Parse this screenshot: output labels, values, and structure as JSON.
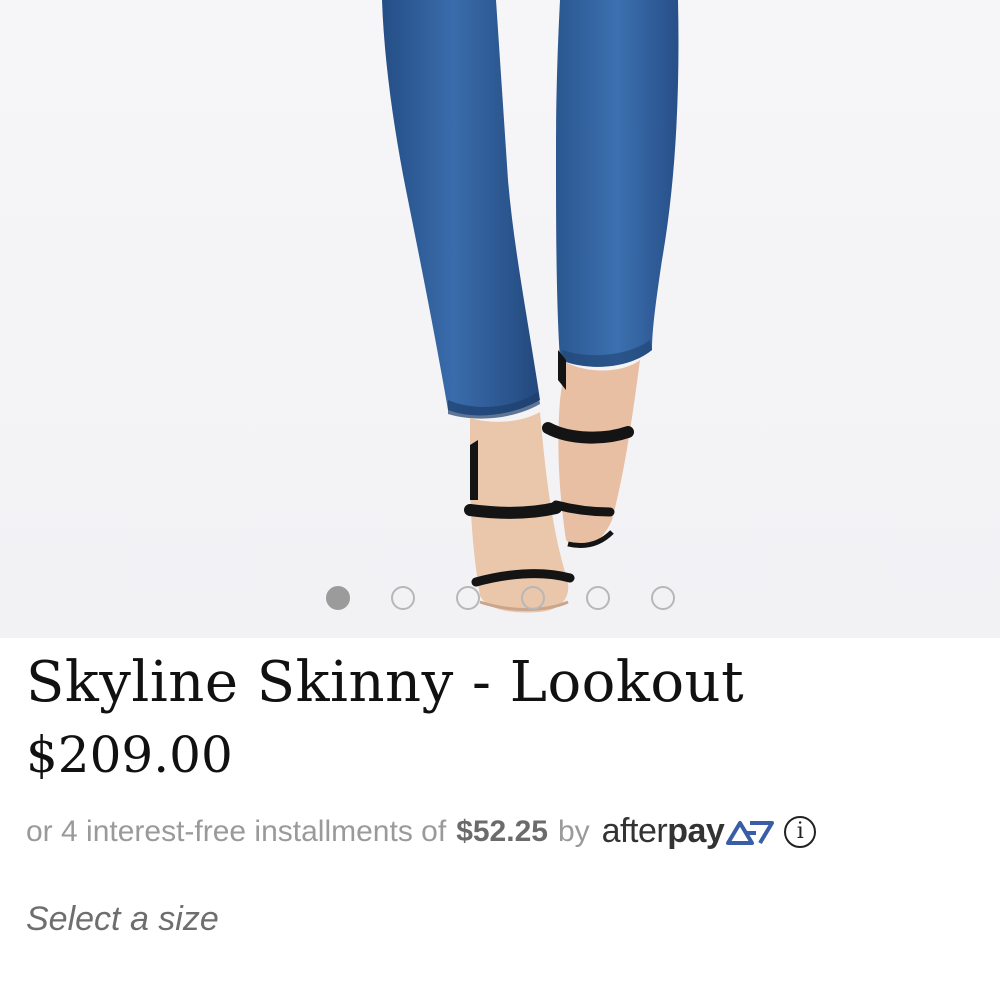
{
  "product": {
    "image_alt": "Model wearing Skyline Skinny jeans in Lookout wash with black strappy heeled sandals",
    "title": "Skyline Skinny - Lookout",
    "price": "$209.00",
    "carousel": {
      "count": 6,
      "active_index": 0
    }
  },
  "afterpay": {
    "prefix": "or 4 interest-free installments of",
    "amount": "$52.25",
    "by": "by",
    "brand_after": "after",
    "brand_pay": "pay",
    "info_icon": "info-icon",
    "brand_color": "#3a5da8"
  },
  "size_selector": {
    "label": "Select a size"
  },
  "colors": {
    "denim": "#2f5f9e",
    "sandal": "#141414",
    "skin": "#e9c3a8",
    "dot_active": "#9b9b9b"
  }
}
